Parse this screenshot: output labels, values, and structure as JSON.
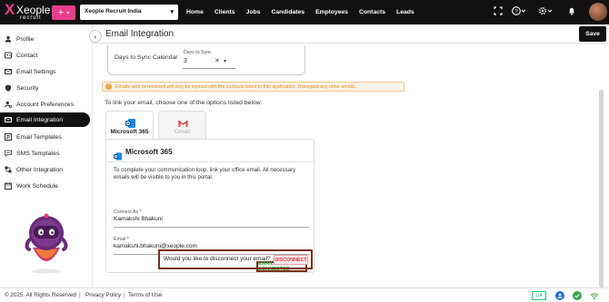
{
  "header": {
    "logo_text": "Xeople",
    "logo_sub": "recruit",
    "add_button_label": "+",
    "company_select": "Xeople Recruit India",
    "nav": [
      "Home",
      "Clients",
      "Jobs",
      "Candidates",
      "Employees",
      "Contacts",
      "Leads"
    ]
  },
  "sidebar": {
    "items": [
      {
        "label": "Profile",
        "icon": "person-icon"
      },
      {
        "label": "Contact",
        "icon": "contact-card-icon"
      },
      {
        "label": "Email Settings",
        "icon": "mail-icon"
      },
      {
        "label": "Security",
        "icon": "shield-icon"
      },
      {
        "label": "Account Preferences",
        "icon": "person-settings-icon"
      },
      {
        "label": "Email Integration",
        "icon": "mail-link-icon"
      },
      {
        "label": "Email Templates",
        "icon": "template-icon"
      },
      {
        "label": "SMS Templates",
        "icon": "sms-icon"
      },
      {
        "label": "Other Integration",
        "icon": "integration-icon"
      },
      {
        "label": "Work Schedule",
        "icon": "calendar-icon"
      }
    ],
    "active_index": 5
  },
  "main": {
    "title": "Email Integration",
    "save_label": "Save",
    "sync": {
      "row_label": "Days to Sync Calendar",
      "field_label": "Days to Sync",
      "field_value": "3"
    },
    "notice": "Emails sent or received will only be synced with the contacts listed in this application. Disregard any other emails.",
    "choose_text": "To link your email, choose one of the options listed below:",
    "tabs": [
      {
        "label": "Microsoft 365",
        "active": true
      },
      {
        "label": "Gmail",
        "active": false
      }
    ],
    "card": {
      "title": "Microsoft 365",
      "description": "To complete your communication loop, link your office email. All necessary emails will be visible to you in this portal.",
      "connect_as_label": "Connect As *",
      "connect_as_value": "Kamakshi Bhakuni",
      "email_label": "Email *",
      "email_value": "kamakshi.bhakuni@xeople.com",
      "status": "EMAIL CONNECTED",
      "disconnect_question": "Would you like to disconnect your email?",
      "disconnect_label": "DISCONNECT"
    }
  },
  "footer": {
    "copyright": "© 2025. All Rights Reserved",
    "privacy": "Privacy Policy",
    "terms": "Terms of Use",
    "qa": "QA"
  },
  "colors": {
    "brand_pink": "#e83e8c",
    "dark": "#111111",
    "connected_green": "#3a9b3a",
    "disconnect_red": "#dd3333",
    "notice_orange": "#e08a1e"
  }
}
